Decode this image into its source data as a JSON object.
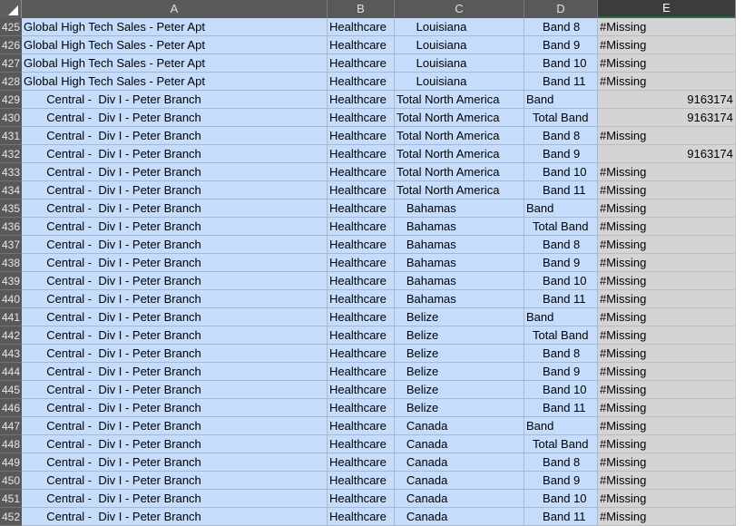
{
  "colors": {
    "header_bg": "#595959",
    "selection_bg": "#c5dcfa",
    "active_column_bg": "#d4d4d4",
    "selected_column_underline": "#217346"
  },
  "column_headers": [
    "A",
    "B",
    "C",
    "D",
    "E"
  ],
  "selected_column": "E",
  "rows": [
    {
      "n": "425",
      "a": "Global High Tech Sales - Peter Apt",
      "b": "Healthcare",
      "c": "      Louisiana",
      "d": "     Band 8",
      "e": "#Missing"
    },
    {
      "n": "426",
      "a": "Global High Tech Sales - Peter Apt",
      "b": "Healthcare",
      "c": "      Louisiana",
      "d": "     Band 9",
      "e": "#Missing"
    },
    {
      "n": "427",
      "a": "Global High Tech Sales - Peter Apt",
      "b": "Healthcare",
      "c": "      Louisiana",
      "d": "     Band 10",
      "e": "#Missing"
    },
    {
      "n": "428",
      "a": "Global High Tech Sales - Peter Apt",
      "b": "Healthcare",
      "c": "      Louisiana",
      "d": "     Band 11",
      "e": "#Missing"
    },
    {
      "n": "429",
      "a": "       Central -  Div I - Peter Branch",
      "b": "Healthcare",
      "c": "Total North America",
      "d": "Band",
      "e": "9163174"
    },
    {
      "n": "430",
      "a": "       Central -  Div I - Peter Branch",
      "b": "Healthcare",
      "c": "Total North America",
      "d": "  Total Band",
      "e": "9163174"
    },
    {
      "n": "431",
      "a": "       Central -  Div I - Peter Branch",
      "b": "Healthcare",
      "c": "Total North America",
      "d": "     Band 8",
      "e": "#Missing"
    },
    {
      "n": "432",
      "a": "       Central -  Div I - Peter Branch",
      "b": "Healthcare",
      "c": "Total North America",
      "d": "     Band 9",
      "e": "9163174"
    },
    {
      "n": "433",
      "a": "       Central -  Div I - Peter Branch",
      "b": "Healthcare",
      "c": "Total North America",
      "d": "     Band 10",
      "e": "#Missing"
    },
    {
      "n": "434",
      "a": "       Central -  Div I - Peter Branch",
      "b": "Healthcare",
      "c": "Total North America",
      "d": "     Band 11",
      "e": "#Missing"
    },
    {
      "n": "435",
      "a": "       Central -  Div I - Peter Branch",
      "b": "Healthcare",
      "c": "   Bahamas",
      "d": "Band",
      "e": "#Missing"
    },
    {
      "n": "436",
      "a": "       Central -  Div I - Peter Branch",
      "b": "Healthcare",
      "c": "   Bahamas",
      "d": "  Total Band",
      "e": "#Missing"
    },
    {
      "n": "437",
      "a": "       Central -  Div I - Peter Branch",
      "b": "Healthcare",
      "c": "   Bahamas",
      "d": "     Band 8",
      "e": "#Missing"
    },
    {
      "n": "438",
      "a": "       Central -  Div I - Peter Branch",
      "b": "Healthcare",
      "c": "   Bahamas",
      "d": "     Band 9",
      "e": "#Missing"
    },
    {
      "n": "439",
      "a": "       Central -  Div I - Peter Branch",
      "b": "Healthcare",
      "c": "   Bahamas",
      "d": "     Band 10",
      "e": "#Missing"
    },
    {
      "n": "440",
      "a": "       Central -  Div I - Peter Branch",
      "b": "Healthcare",
      "c": "   Bahamas",
      "d": "     Band 11",
      "e": "#Missing"
    },
    {
      "n": "441",
      "a": "       Central -  Div I - Peter Branch",
      "b": "Healthcare",
      "c": "   Belize",
      "d": "Band",
      "e": "#Missing"
    },
    {
      "n": "442",
      "a": "       Central -  Div I - Peter Branch",
      "b": "Healthcare",
      "c": "   Belize",
      "d": "  Total Band",
      "e": "#Missing"
    },
    {
      "n": "443",
      "a": "       Central -  Div I - Peter Branch",
      "b": "Healthcare",
      "c": "   Belize",
      "d": "     Band 8",
      "e": "#Missing"
    },
    {
      "n": "444",
      "a": "       Central -  Div I - Peter Branch",
      "b": "Healthcare",
      "c": "   Belize",
      "d": "     Band 9",
      "e": "#Missing"
    },
    {
      "n": "445",
      "a": "       Central -  Div I - Peter Branch",
      "b": "Healthcare",
      "c": "   Belize",
      "d": "     Band 10",
      "e": "#Missing"
    },
    {
      "n": "446",
      "a": "       Central -  Div I - Peter Branch",
      "b": "Healthcare",
      "c": "   Belize",
      "d": "     Band 11",
      "e": "#Missing"
    },
    {
      "n": "447",
      "a": "       Central -  Div I - Peter Branch",
      "b": "Healthcare",
      "c": "   Canada",
      "d": "Band",
      "e": "#Missing"
    },
    {
      "n": "448",
      "a": "       Central -  Div I - Peter Branch",
      "b": "Healthcare",
      "c": "   Canada",
      "d": "  Total Band",
      "e": "#Missing"
    },
    {
      "n": "449",
      "a": "       Central -  Div I - Peter Branch",
      "b": "Healthcare",
      "c": "   Canada",
      "d": "     Band 8",
      "e": "#Missing"
    },
    {
      "n": "450",
      "a": "       Central -  Div I - Peter Branch",
      "b": "Healthcare",
      "c": "   Canada",
      "d": "     Band 9",
      "e": "#Missing"
    },
    {
      "n": "451",
      "a": "       Central -  Div I - Peter Branch",
      "b": "Healthcare",
      "c": "   Canada",
      "d": "     Band 10",
      "e": "#Missing"
    },
    {
      "n": "452",
      "a": "       Central -  Div I - Peter Branch",
      "b": "Healthcare",
      "c": "   Canada",
      "d": "     Band 11",
      "e": "#Missing"
    }
  ]
}
